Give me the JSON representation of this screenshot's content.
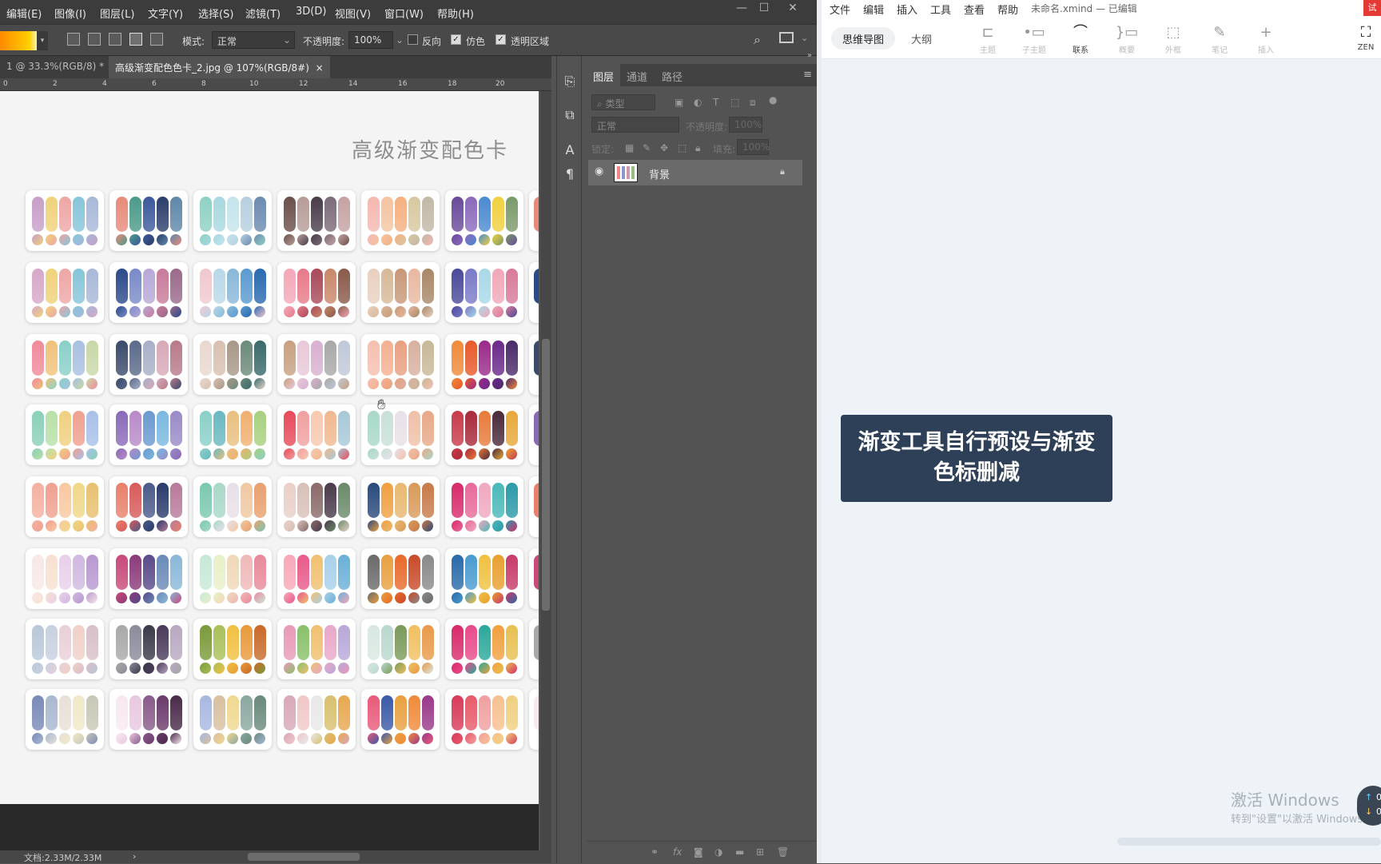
{
  "ps": {
    "menu": [
      "编辑(E)",
      "图像(I)",
      "图层(L)",
      "文字(Y)",
      "选择(S)",
      "滤镜(T)",
      "3D(D)",
      "视图(V)",
      "窗口(W)",
      "帮助(H)"
    ],
    "options": {
      "mode_label": "模式:",
      "mode_value": "正常",
      "opacity_label": "不透明度:",
      "opacity_value": "100%",
      "reverse_label": "反向",
      "dither_label": "仿色",
      "transparency_label": "透明区域",
      "reverse_checked": false,
      "dither_checked": true,
      "transparency_checked": true
    },
    "tabs": {
      "tab1": "1 @ 33.3%(RGB/8) *",
      "tab2": "高级渐变配色色卡_2.jpg @ 107%(RGB/8#)"
    },
    "ruler_ticks": [
      "0",
      "2",
      "4",
      "6",
      "8",
      "10",
      "12",
      "14",
      "16",
      "18",
      "20"
    ],
    "canvas_title": "高级渐变配色卡",
    "status": "文档:2.33M/2.33M",
    "layers_panel": {
      "tabs": [
        "图层",
        "通道",
        "路径"
      ],
      "search_placeholder": "类型",
      "blend_mode": "正常",
      "opacity_label": "不透明度:",
      "opacity_value": "100%",
      "lock_label": "锁定:",
      "fill_label": "填充:",
      "fill_value": "100%",
      "layer_name": "背景"
    }
  },
  "xmind": {
    "menu": [
      "文件",
      "编辑",
      "插入",
      "工具",
      "查看",
      "帮助"
    ],
    "title": "未命名.xmind — 已编辑",
    "view_tabs": [
      "思维导图",
      "大纲"
    ],
    "toolbar": [
      "主题",
      "子主题",
      "联系",
      "概要",
      "外框",
      "笔记",
      "插入"
    ],
    "zen_label": "ZEN",
    "node_text": "渐变工具自行预设与渐变色标删减",
    "watermark_title": "激活 Windows",
    "watermark_sub": "转到\"设置\"以激活 Windows。",
    "badge_values": [
      "0",
      "0"
    ]
  },
  "colors": {
    "ps_bg": "#535353",
    "node_bg": "#2e3f58",
    "mindmap_bg": "#eef3f8"
  },
  "palettes": [
    [
      "#c79fc8",
      "#f0d27a",
      "#eea6a6",
      "#86c5da",
      "#a8b8d8"
    ],
    [
      "#e88a7a",
      "#4c9a8a",
      "#3c5a9c",
      "#2c3e6c",
      "#5f87a8"
    ],
    [
      "#8fd0c4",
      "#a8d8e0",
      "#c4e4ec",
      "#b6cfe0",
      "#6b8bb0"
    ],
    [
      "#6b4f4a",
      "#b79c98",
      "#4a3d4a",
      "#7a6b78",
      "#c6a2a2"
    ],
    [
      "#f4b8b0",
      "#f4c4a0",
      "#f4b080",
      "#d8c8a0",
      "#c2b8a8"
    ],
    [
      "#6a4a9a",
      "#8a6aba",
      "#4a8ad0",
      "#f0d040",
      "#7a9a6a"
    ],
    [
      "#d6a8c8",
      "#f0d27a",
      "#eea6a6",
      "#86c5da",
      "#a8b8d8"
    ],
    [
      "#2c4a8a",
      "#7a8ac8",
      "#b8a8d8",
      "#c87a9a",
      "#9a6a8a"
    ],
    [
      "#f0c8d0",
      "#b8d8e8",
      "#8ab8d8",
      "#5a9ad0",
      "#2a6ab0"
    ],
    [
      "#f4a8b8",
      "#e87a8a",
      "#a84a5a",
      "#c8886a",
      "#8a5a4a"
    ],
    [
      "#e8d0c0",
      "#d8b898",
      "#c89878",
      "#e8b8a0",
      "#a88868"
    ],
    [
      "#4a4a9a",
      "#7a7ac8",
      "#a8d8e8",
      "#f0a8b8",
      "#d87a9a"
    ],
    [
      "#f08a9a",
      "#f0c27a",
      "#8ad0c8",
      "#a8c0e0",
      "#c8d8a8"
    ],
    [
      "#3a4a6a",
      "#5a6a8a",
      "#a8b0c8",
      "#d8a8b8",
      "#b87a8a"
    ],
    [
      "#e8d8d0",
      "#d8c0b0",
      "#a89888",
      "#6a8a7a",
      "#3a6a6a"
    ],
    [
      "#c8a080",
      "#e8c8d8",
      "#d8b0d0",
      "#a8a8a8",
      "#c0c8d8"
    ],
    [
      "#f4c0b0",
      "#f4b090",
      "#e8a080",
      "#d8b0a0",
      "#c8b898"
    ],
    [
      "#f08a3a",
      "#e85a2a",
      "#9a2a8a",
      "#6a2a8a",
      "#4a2a6a"
    ],
    [
      "#8ad0b8",
      "#b8e0a8",
      "#f0d080",
      "#f0a090",
      "#a8c0e8"
    ],
    [
      "#8a6ab8",
      "#b88ac8",
      "#6a9ad0",
      "#7ab8e0",
      "#9a8ac8"
    ],
    [
      "#8ad0c8",
      "#6ab8c0",
      "#e8c080",
      "#f0b070",
      "#a8d080"
    ],
    [
      "#e84a5a",
      "#f0a0a0",
      "#f8c8b0",
      "#f0b890",
      "#a8c8d8"
    ],
    [
      "#a8d8c8",
      "#c8e0d8",
      "#e8e0e8",
      "#f0c0a8",
      "#e8a888"
    ],
    [
      "#c83a4a",
      "#a82a3a",
      "#e87a3a",
      "#4a2a3a",
      "#e8a83a"
    ],
    [
      "#f4b0a0",
      "#f0a090",
      "#f8c8a0",
      "#f0d888",
      "#e8c070"
    ],
    [
      "#e8806a",
      "#d85a5a",
      "#4a5a8a",
      "#2a3a6a",
      "#b87a9a"
    ],
    [
      "#7ac8b0",
      "#a8d8c8",
      "#e8e0e8",
      "#f0c8a0",
      "#e8a070"
    ],
    [
      "#e8d0c8",
      "#d8c0b8",
      "#8a6a6a",
      "#4a3a4a",
      "#6a8a6a"
    ],
    [
      "#2a4a7a",
      "#f0a040",
      "#e8b870",
      "#d89a5a",
      "#c87a4a"
    ],
    [
      "#d82a6a",
      "#e86a9a",
      "#f0a8c0",
      "#4ab8b8",
      "#2a9aa8"
    ],
    [
      "#f8e8e8",
      "#f8e0d0",
      "#e8d0e8",
      "#d0b8e0",
      "#b898d0"
    ],
    [
      "#c84a7a",
      "#8a3a7a",
      "#5a4a8a",
      "#6a8ab8",
      "#8ab8d8"
    ],
    [
      "#c8e8d8",
      "#e8f0c8",
      "#f0d8b8",
      "#f0b8b8",
      "#e88a9a"
    ],
    [
      "#f8a8b8",
      "#e85a8a",
      "#f0c070",
      "#a8d0e8",
      "#6ab0d8"
    ],
    [
      "#6a6a6a",
      "#e8a040",
      "#e86a2a",
      "#c84a2a",
      "#8a8a8a"
    ],
    [
      "#2a6aa8",
      "#4a9ad0",
      "#f0c040",
      "#e8a030",
      "#c83a6a"
    ],
    [
      "#b8c8d8",
      "#c8d0e0",
      "#e8d0d8",
      "#f0d0c8",
      "#d8c0c8"
    ],
    [
      "#a8a8a8",
      "#8a8a9a",
      "#3a3a4a",
      "#4a3a5a",
      "#b8a8c0"
    ],
    [
      "#7a9a3a",
      "#a8c05a",
      "#f0c040",
      "#e89a3a",
      "#c86a2a"
    ],
    [
      "#e89ab8",
      "#8ac06a",
      "#f0c070",
      "#e8a8c8",
      "#b8a8d8"
    ],
    [
      "#d8e8e0",
      "#b8d8d0",
      "#7a9a5a",
      "#f0c060",
      "#e89a4a"
    ],
    [
      "#d82a6a",
      "#e84a8a",
      "#2aa89a",
      "#f0a040",
      "#e8c050"
    ],
    [
      "#7a8ab8",
      "#a8b8d0",
      "#e8e0d8",
      "#f0e8c8",
      "#c8c8b8"
    ],
    [
      "#f8e8f0",
      "#e8c8e0",
      "#8a5a8a",
      "#6a3a6a",
      "#4a2a4a"
    ],
    [
      "#a8b8e0",
      "#d8c0a0",
      "#f0d890",
      "#8aa8a0",
      "#6a8a7a"
    ],
    [
      "#d8a8b8",
      "#f0c8c8",
      "#e8e8e8",
      "#d8c070",
      "#e8a850"
    ],
    [
      "#e85a7a",
      "#3a5aa8",
      "#e8a040",
      "#f08a3a",
      "#9a3a8a"
    ],
    [
      "#d83a5a",
      "#e85a6a",
      "#f0a0a0",
      "#f8c090",
      "#f0d080"
    ]
  ]
}
